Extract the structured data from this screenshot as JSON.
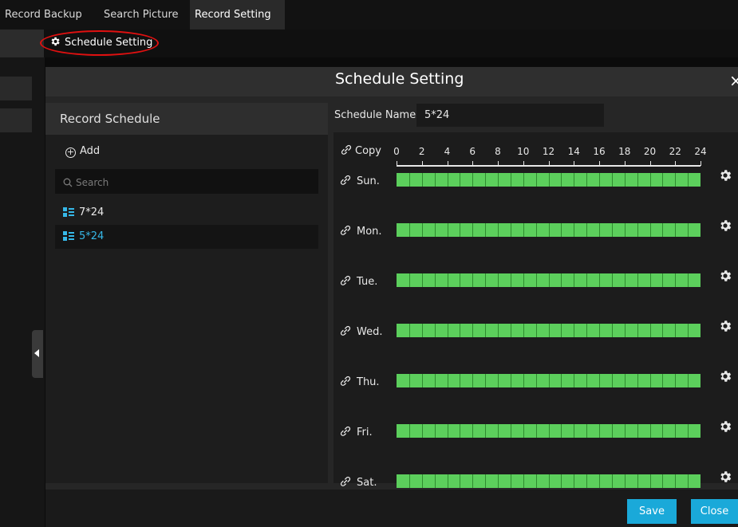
{
  "tabs": [
    {
      "label": "Record Backup"
    },
    {
      "label": "Search Picture"
    },
    {
      "label": "Record Setting"
    }
  ],
  "toolbar": {
    "schedule_setting_label": "Schedule Setting"
  },
  "dialog": {
    "title": "Schedule Setting",
    "close_symbol": "×",
    "record_schedule_title": "Record Schedule",
    "add_label": "Add",
    "search_placeholder": "Search",
    "schedules": [
      {
        "label": "7*24",
        "selected": false
      },
      {
        "label": "5*24",
        "selected": true
      }
    ],
    "schedule_name_label": "Schedule Name",
    "schedule_name_value": "5*24",
    "copy_label": "Copy",
    "hours": [
      "0",
      "2",
      "4",
      "6",
      "8",
      "10",
      "12",
      "14",
      "16",
      "18",
      "20",
      "22",
      "24"
    ],
    "days": [
      {
        "label": "Sun.",
        "coverage": "0-24"
      },
      {
        "label": "Mon.",
        "coverage": "0-24"
      },
      {
        "label": "Tue.",
        "coverage": "0-24"
      },
      {
        "label": "Wed.",
        "coverage": "0-24"
      },
      {
        "label": "Thu.",
        "coverage": "0-24"
      },
      {
        "label": "Fri.",
        "coverage": "0-24"
      },
      {
        "label": "Sat.",
        "coverage": "0-24"
      }
    ],
    "save_label": "Save",
    "close_label": "Close"
  },
  "colors": {
    "accent": "#1aa9d9",
    "selected_text": "#36b8e8",
    "schedule_fill": "#5ccf5c",
    "highlight_circle": "#e01010"
  },
  "icons": {
    "toolbar": "gear-icon",
    "add": "plus-circle-icon",
    "search": "search-icon",
    "schedule_item": "schedule-list-icon",
    "copy": "link-icon",
    "row_settings": "gear-icon",
    "collapse": "triangle-left-icon"
  }
}
